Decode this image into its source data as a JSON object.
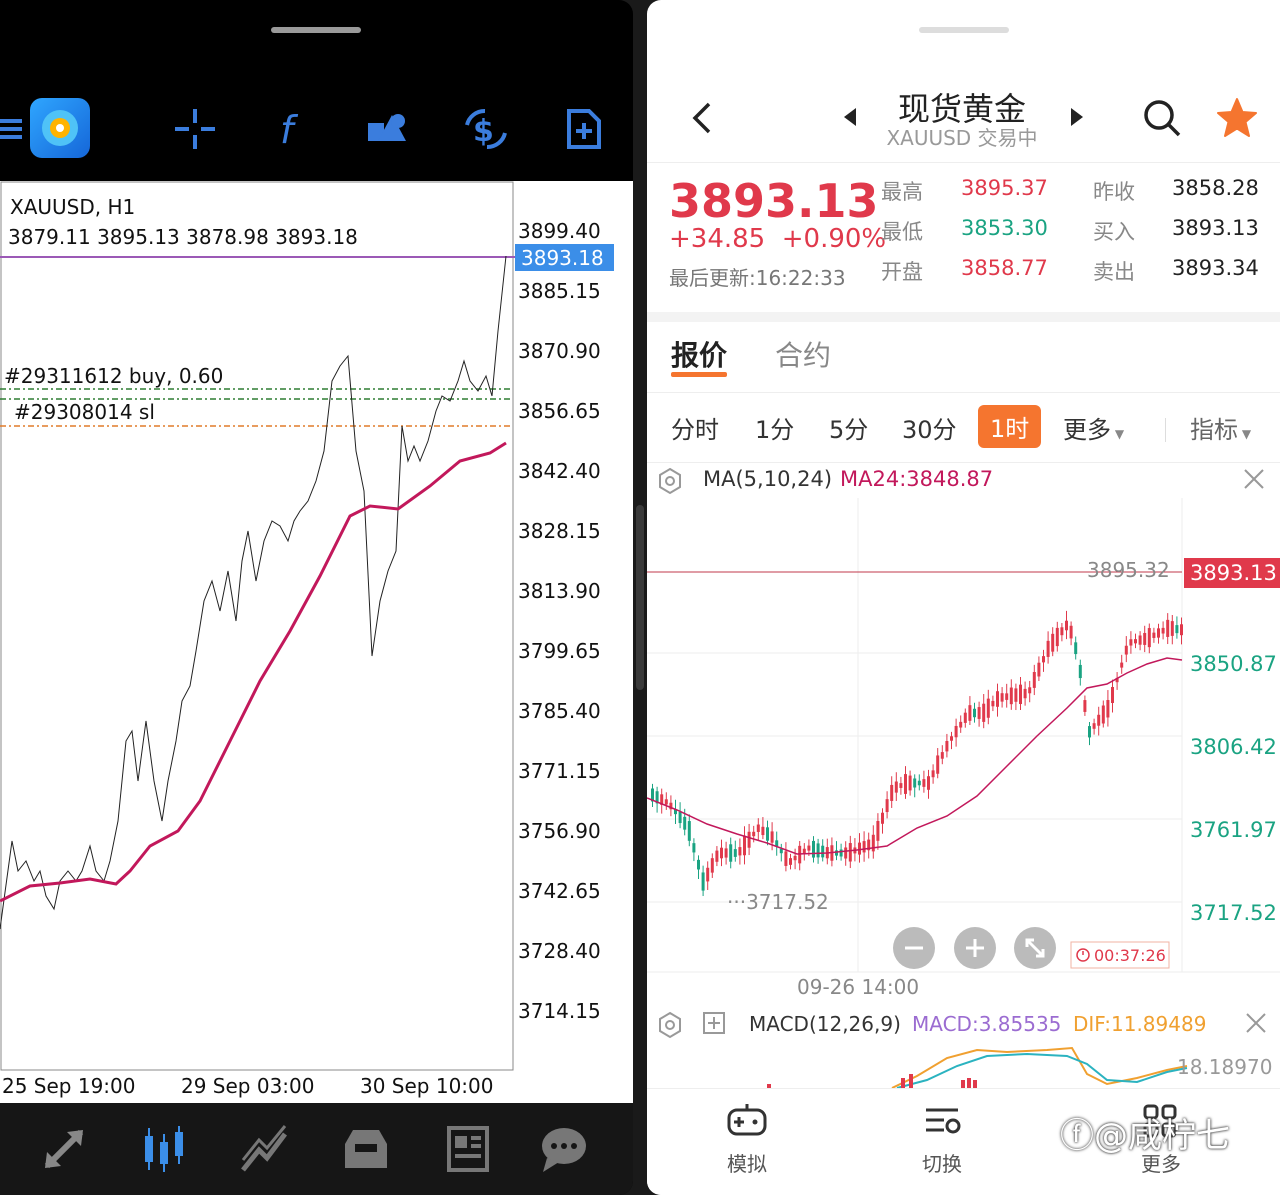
{
  "left_app": {
    "toolbar": {
      "items": [
        "menu",
        "crosshair",
        "indicators",
        "objects",
        "trade",
        "new-order"
      ]
    },
    "chart": {
      "symbol": "XAUUSD, H1",
      "ohlc": "3879.11 3895.13 3878.98 3893.18",
      "current_price": "3893.18",
      "orders": [
        {
          "label": "#29311612 buy, 0.60"
        },
        {
          "label": "#29308014 sl"
        }
      ],
      "price_axis": [
        "3899.40",
        "3885.15",
        "3870.90",
        "3856.65",
        "3842.40",
        "3828.15",
        "3813.90",
        "3799.65",
        "3785.40",
        "3771.15",
        "3756.90",
        "3742.65",
        "3728.40",
        "3714.15"
      ],
      "time_axis": [
        "25 Sep 19:00",
        "29 Sep 03:00",
        "30 Sep 10:00"
      ],
      "colors": {
        "price_line": "#9b59b6",
        "ma": "#c2185b",
        "buy_line": "#2e7d32",
        "sl_line": "#e07b2a",
        "badge": "#3b8ee8"
      }
    },
    "bottom_nav": [
      "quotes",
      "chart",
      "trade",
      "history",
      "news",
      "messages"
    ]
  },
  "right_app": {
    "title": "现货黄金",
    "subtitle": "XAUUSD 交易中",
    "quote": {
      "price": "3893.13",
      "change": "+34.85",
      "change_pct": "+0.90%",
      "updated": "最后更新:16:22:33",
      "high_label": "最高",
      "high": "3895.37",
      "low_label": "最低",
      "low": "3853.30",
      "open_label": "开盘",
      "open": "3858.77",
      "prev_label": "昨收",
      "prev": "3858.28",
      "bid_label": "买入",
      "bid": "3893.13",
      "ask_label": "卖出",
      "ask": "3893.34"
    },
    "tabs": [
      "报价",
      "合约"
    ],
    "periods": [
      "分时",
      "1分",
      "5分",
      "30分",
      "1时",
      "更多",
      "指标"
    ],
    "active_period": "1时",
    "ma_label": "MA(5,10,24)",
    "ma24_label": "MA24:3848.87",
    "chart": {
      "price_tag": "3893.13",
      "high_mark": "3895.32",
      "low_mark": "3717.52",
      "axis": [
        "3850.87",
        "3806.42",
        "3761.97",
        "3717.52"
      ],
      "time_label": "09-26 14:00",
      "timer": "00:37:26"
    },
    "macd": {
      "label": "MACD(12,26,9)",
      "macd_value": "MACD:3.85535",
      "dif_value": "DIF:11.89489",
      "axis_value": "18.18970"
    },
    "bottom_nav": [
      {
        "label": "模拟"
      },
      {
        "label": "切换"
      },
      {
        "label": "更多"
      }
    ],
    "watermark": "@咸柠七"
  }
}
